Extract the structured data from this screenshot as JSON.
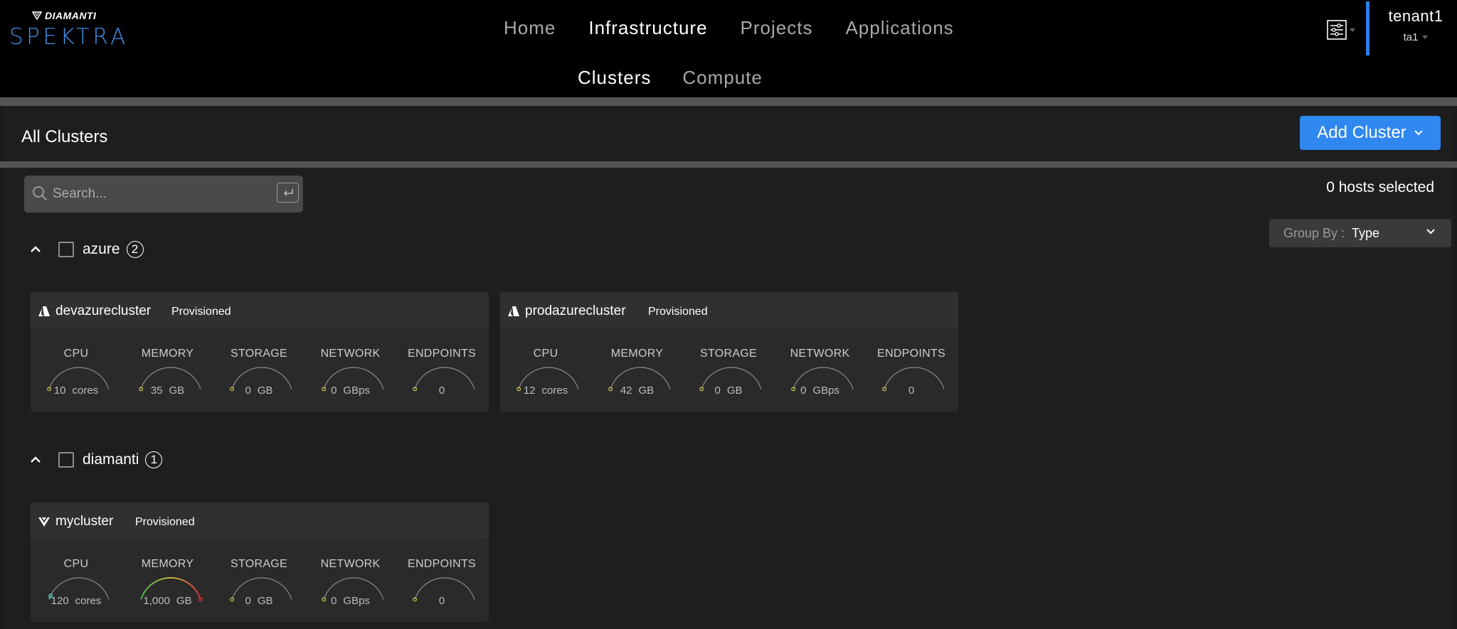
{
  "app": {
    "brand": "DIAMANTI",
    "product": "SPEKTRA"
  },
  "nav": {
    "items": [
      "Home",
      "Infrastructure",
      "Projects",
      "Applications"
    ],
    "active": "Infrastructure",
    "sub_items": [
      "Clusters",
      "Compute"
    ],
    "sub_active": "Clusters"
  },
  "user": {
    "tenant": "tenant1",
    "account": "ta1"
  },
  "page": {
    "title": "All Clusters",
    "add_button": "Add Cluster"
  },
  "search": {
    "placeholder": "Search..."
  },
  "selection": {
    "text": "0 hosts selected"
  },
  "group_by": {
    "label": "Group By :",
    "value": "Type"
  },
  "metric_labels": [
    "CPU",
    "MEMORY",
    "STORAGE",
    "NETWORK",
    "ENDPOINTS"
  ],
  "groups": [
    {
      "name": "azure",
      "count": "2",
      "clusters": [
        {
          "name": "devazurecluster",
          "status": "Provisioned",
          "icon": "azure-icon",
          "metrics": [
            {
              "value": "10",
              "unit": "cores",
              "fraction": 0
            },
            {
              "value": "35",
              "unit": "GB",
              "fraction": 0
            },
            {
              "value": "0",
              "unit": "GB",
              "fraction": 0
            },
            {
              "value": "0",
              "unit": "GBps",
              "fraction": 0
            },
            {
              "value": "0",
              "unit": "",
              "fraction": 0
            }
          ]
        },
        {
          "name": "prodazurecluster",
          "status": "Provisioned",
          "icon": "azure-icon",
          "metrics": [
            {
              "value": "12",
              "unit": "cores",
              "fraction": 0
            },
            {
              "value": "42",
              "unit": "GB",
              "fraction": 0
            },
            {
              "value": "0",
              "unit": "GB",
              "fraction": 0
            },
            {
              "value": "0",
              "unit": "GBps",
              "fraction": 0
            },
            {
              "value": "0",
              "unit": "",
              "fraction": 0
            }
          ]
        }
      ]
    },
    {
      "name": "diamanti",
      "count": "1",
      "clusters": [
        {
          "name": "mycluster",
          "status": "Provisioned",
          "icon": "diamanti-icon",
          "metrics": [
            {
              "value": "120",
              "unit": "cores",
              "fraction": 0.05
            },
            {
              "value": "1,000",
              "unit": "GB",
              "fraction": 1.0
            },
            {
              "value": "0",
              "unit": "GB",
              "fraction": 0
            },
            {
              "value": "0",
              "unit": "GBps",
              "fraction": 0
            },
            {
              "value": "0",
              "unit": "",
              "fraction": 0
            }
          ]
        }
      ]
    }
  ],
  "colors": {
    "accent": "#2f87f0",
    "brand": "#3b8fe8",
    "gauge_track": "#8a8a8a",
    "gauge_zero_dot": "#c8c84a",
    "gauge_full_dot": "#e03030"
  }
}
